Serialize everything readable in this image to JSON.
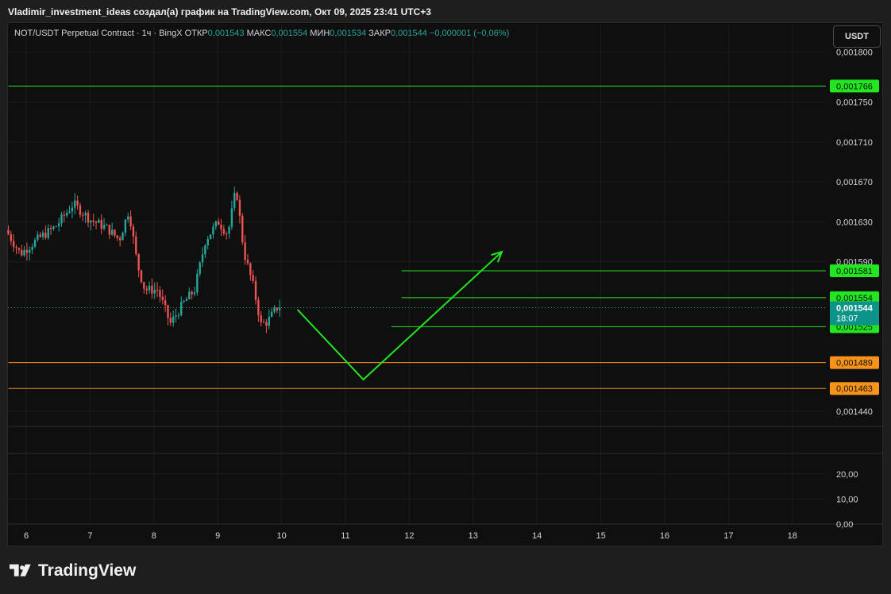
{
  "header": {
    "title": "Vladimir_investment_ideas создал(а) график на TradingView.com, Окт 09, 2025 23:41 UTC+3"
  },
  "legend": {
    "symbol": "NOT/USDT Perpetual Contract · 1ч · BingX",
    "open_label": "ОТКР",
    "open_value": "0,001543",
    "high_label": "МАКС",
    "high_value": "0,001554",
    "low_label": "МИН",
    "low_value": "0,001534",
    "close_label": "ЗАКР",
    "close_value": "0,001544",
    "change": "−0,000001 (−0,06%)"
  },
  "currency_button": {
    "label": "USDT"
  },
  "footer": {
    "brand": "TradingView"
  },
  "colors": {
    "up": "#26a69a",
    "down": "#ef5350",
    "green_line": "#22e61f",
    "orange_line": "#f7931a",
    "current_price_bg": "#0d9488"
  },
  "chart_data": {
    "type": "candlestick",
    "x_ticks": [
      "6",
      "7",
      "8",
      "9",
      "10",
      "11",
      "12",
      "13",
      "14",
      "15",
      "16",
      "17",
      "18"
    ],
    "y_ticks": [
      "0,001800",
      "0,001750",
      "0,001710",
      "0,001670",
      "0,001630",
      "0,001590",
      "0,001440"
    ],
    "y_range": [
      0.001425,
      0.00183
    ],
    "volume_ticks": [
      "20,00",
      "10,00",
      "0,00"
    ],
    "volume_range": [
      0,
      25
    ],
    "current_price": {
      "value": 0.001544,
      "label": "0,001544",
      "timer": "18:07"
    },
    "horizontal_levels": [
      {
        "value": 0.001766,
        "label": "0,001766",
        "color": "green",
        "start_day": 5.72
      },
      {
        "value": 0.001581,
        "label": "0,001581",
        "color": "green",
        "start_day": 11.88
      },
      {
        "value": 0.001554,
        "label": "0,001554",
        "color": "green",
        "start_day": 11.88
      },
      {
        "value": 0.001525,
        "label": "0,001525",
        "color": "green",
        "start_day": 11.72
      },
      {
        "value": 0.001489,
        "label": "0,001489",
        "color": "orange",
        "start_day": 5.72
      },
      {
        "value": 0.001463,
        "label": "0,001463",
        "color": "orange",
        "start_day": 5.72
      }
    ],
    "projection_path": [
      {
        "day": 10.25,
        "price": 0.001542
      },
      {
        "day": 11.28,
        "price": 0.001472
      },
      {
        "day": 13.45,
        "price": 0.0016
      }
    ],
    "candle_anchors": [
      {
        "day": 5.72,
        "price": 0.001622
      },
      {
        "day": 5.95,
        "price": 0.001598
      },
      {
        "day": 6.25,
        "price": 0.001614
      },
      {
        "day": 6.5,
        "price": 0.001625
      },
      {
        "day": 6.78,
        "price": 0.001648
      },
      {
        "day": 7.05,
        "price": 0.001632
      },
      {
        "day": 7.3,
        "price": 0.001624
      },
      {
        "day": 7.5,
        "price": 0.001612
      },
      {
        "day": 7.65,
        "price": 0.001642
      },
      {
        "day": 7.78,
        "price": 0.001588
      },
      {
        "day": 7.9,
        "price": 0.001562
      },
      {
        "day": 8.1,
        "price": 0.001562
      },
      {
        "day": 8.3,
        "price": 0.001528
      },
      {
        "day": 8.5,
        "price": 0.001548
      },
      {
        "day": 8.68,
        "price": 0.001562
      },
      {
        "day": 8.85,
        "price": 0.001612
      },
      {
        "day": 9.05,
        "price": 0.00163
      },
      {
        "day": 9.2,
        "price": 0.001618
      },
      {
        "day": 9.33,
        "price": 0.001664
      },
      {
        "day": 9.45,
        "price": 0.0016
      },
      {
        "day": 9.6,
        "price": 0.001565
      },
      {
        "day": 9.72,
        "price": 0.001527
      },
      {
        "day": 9.82,
        "price": 0.00153
      },
      {
        "day": 9.97,
        "price": 0.001544
      }
    ]
  }
}
